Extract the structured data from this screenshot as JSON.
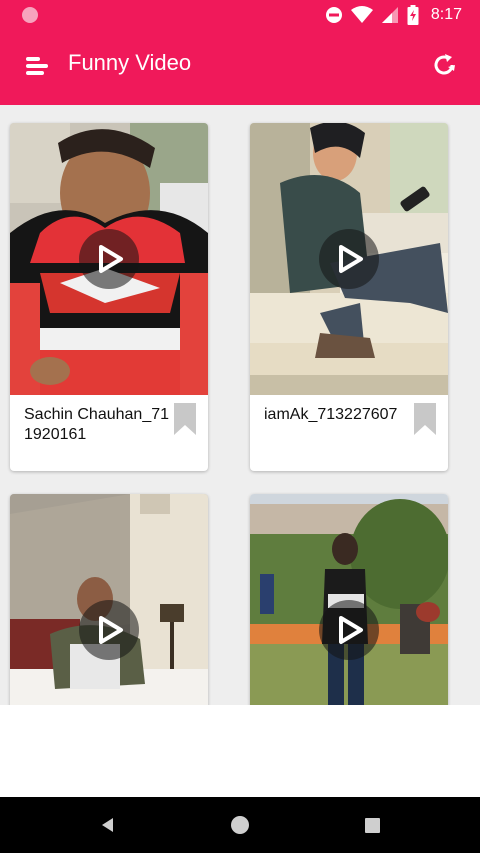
{
  "status_bar": {
    "time": "8:17",
    "icons": [
      "notification-dot-icon",
      "do-not-disturb-icon",
      "wifi-icon",
      "signal-icon",
      "battery-charging-icon"
    ]
  },
  "app_bar": {
    "title": "Funny Video",
    "menu_icon": "menu-icon",
    "refresh_icon": "refresh-icon",
    "color": "#f0195a"
  },
  "videos": [
    {
      "title": "Sachin Chauhan_711920161"
    },
    {
      "title": "iamAk_713227607"
    },
    {
      "title": ""
    },
    {
      "title": ""
    }
  ],
  "nav_bar": {
    "icons": [
      "back-icon",
      "home-icon",
      "recents-icon"
    ]
  }
}
